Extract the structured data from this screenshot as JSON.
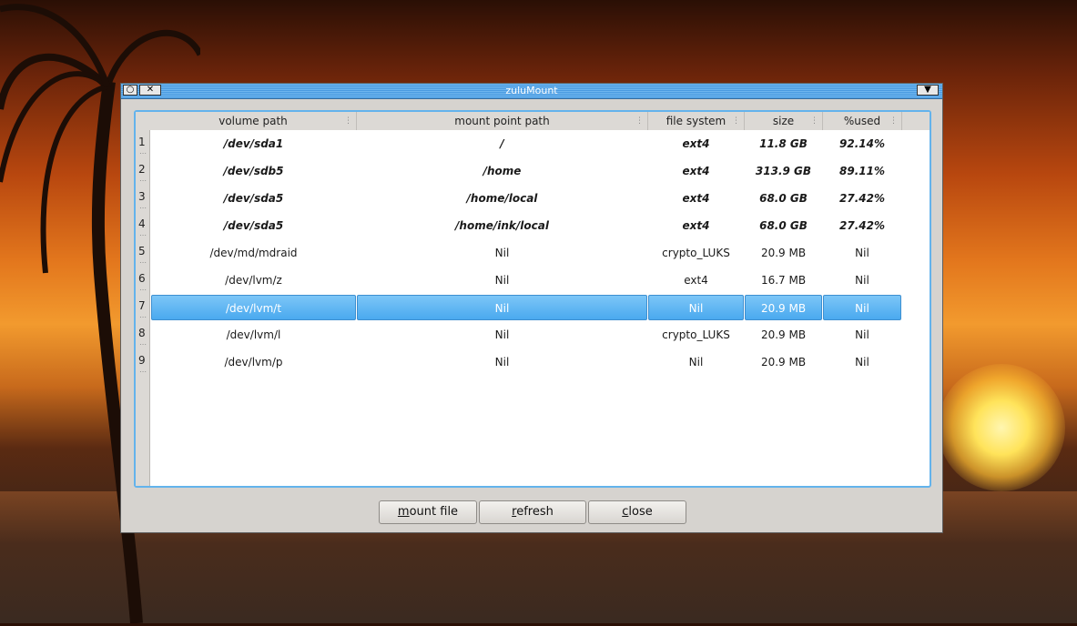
{
  "window": {
    "title": "zuluMount"
  },
  "table": {
    "columns": [
      "volume path",
      "mount point path",
      "file system",
      "size",
      "%used"
    ],
    "rows": [
      {
        "num": "1",
        "volume": "/dev/sda1",
        "mount": "/",
        "fs": "ext4",
        "size": "11.8 GB",
        "used": "92.14%",
        "bold": true
      },
      {
        "num": "2",
        "volume": "/dev/sdb5",
        "mount": "/home",
        "fs": "ext4",
        "size": "313.9 GB",
        "used": "89.11%",
        "bold": true
      },
      {
        "num": "3",
        "volume": "/dev/sda5",
        "mount": "/home/local",
        "fs": "ext4",
        "size": "68.0 GB",
        "used": "27.42%",
        "bold": true
      },
      {
        "num": "4",
        "volume": "/dev/sda5",
        "mount": "/home/ink/local",
        "fs": "ext4",
        "size": "68.0 GB",
        "used": "27.42%",
        "bold": true
      },
      {
        "num": "5",
        "volume": "/dev/md/mdraid",
        "mount": "Nil",
        "fs": "crypto_LUKS",
        "size": "20.9 MB",
        "used": "Nil",
        "bold": false
      },
      {
        "num": "6",
        "volume": "/dev/lvm/z",
        "mount": "Nil",
        "fs": "ext4",
        "size": "16.7 MB",
        "used": "Nil",
        "bold": false
      },
      {
        "num": "7",
        "volume": "/dev/lvm/t",
        "mount": "Nil",
        "fs": "Nil",
        "size": "20.9 MB",
        "used": "Nil",
        "bold": false,
        "selected": true
      },
      {
        "num": "8",
        "volume": "/dev/lvm/l",
        "mount": "Nil",
        "fs": "crypto_LUKS",
        "size": "20.9 MB",
        "used": "Nil",
        "bold": false
      },
      {
        "num": "9",
        "volume": "/dev/lvm/p",
        "mount": "Nil",
        "fs": "Nil",
        "size": "20.9 MB",
        "used": "Nil",
        "bold": false
      }
    ]
  },
  "buttons": {
    "mount_file": {
      "mnemonic": "m",
      "rest": "ount file"
    },
    "refresh": {
      "mnemonic": "r",
      "rest": "efresh"
    },
    "close": {
      "mnemonic": "c",
      "rest": "lose"
    }
  },
  "icons": {
    "window_menu": "circle-icon",
    "close": "close-icon",
    "window_options": "chevron-down-icon"
  },
  "colors": {
    "selection": "#4aa9ef",
    "titlebar": "#4a9ae0"
  }
}
